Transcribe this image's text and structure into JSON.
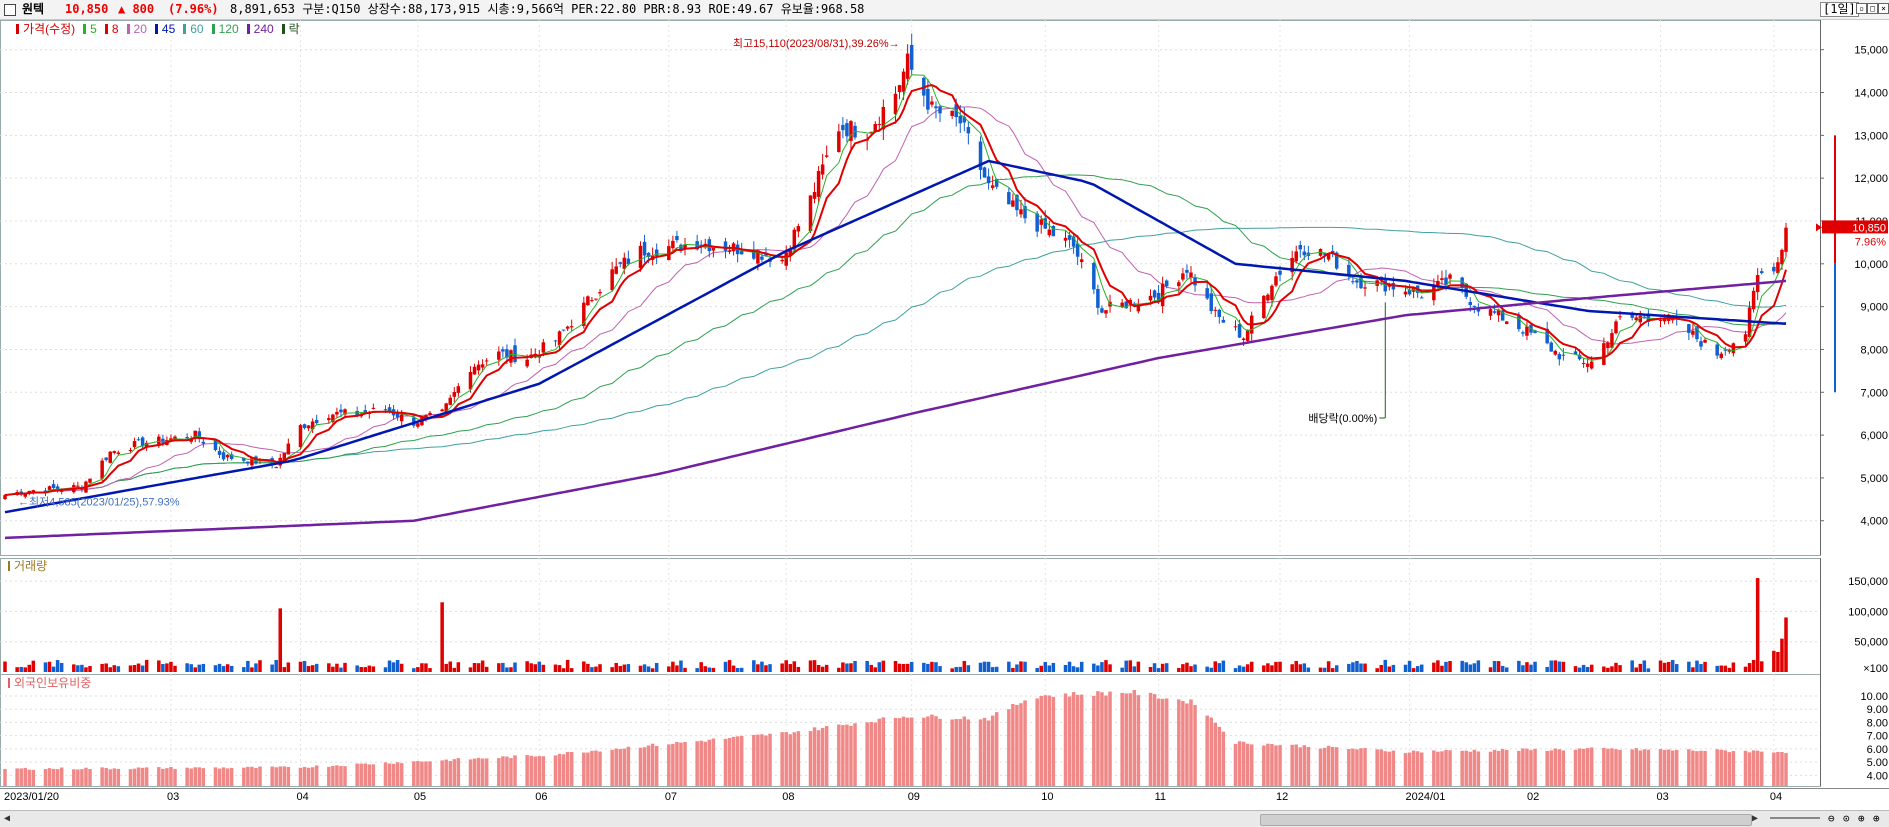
{
  "header": {
    "stock_name": "원텍",
    "price": "10,850",
    "change": "▲ 800",
    "change_pct": "(7.96%)",
    "stats": "8,891,653 구분:Q150 상장수:88,173,915 시총:9,566억 PER:22.80 PBR:8.93 ROE:49.67 유보율:968.58",
    "period": "[1일]"
  },
  "price_panel": {
    "legend": [
      {
        "label": "가격(수정)",
        "color": "#d40000"
      },
      {
        "label": "5",
        "color": "#2bb02b"
      },
      {
        "label": "8",
        "color": "#e00000"
      },
      {
        "label": "20",
        "color": "#c060b0"
      },
      {
        "label": "45",
        "color": "#0018b0"
      },
      {
        "label": "60",
        "color": "#40a0a0"
      },
      {
        "label": "120",
        "color": "#30a050"
      },
      {
        "label": "240",
        "color": "#7020a0"
      },
      {
        "label": "락",
        "color": "#205020"
      }
    ],
    "high_annotation": "최고15,110(2023/08/31),39.26%→",
    "low_annotation": "←최저4,585(2023/01/25),57.93%",
    "dividend_annotation": "배당락(0.00%)",
    "current_price_label": "10,850",
    "current_pct_label": "7.96%"
  },
  "volume_panel": {
    "legend": "거래량"
  },
  "foreign_panel": {
    "legend": "외국인보유비중"
  },
  "x_axis_labels": [
    "2023/01/20",
    "03",
    "04",
    "05",
    "06",
    "07",
    "08",
    "09",
    "10",
    "11",
    "12",
    "2024/01",
    "02",
    "03",
    "04"
  ],
  "chart_data": [
    {
      "type": "candlestick",
      "title": "가격(수정)",
      "y_ticks": [
        "4,000",
        "5,000",
        "6,000",
        "7,000",
        "8,000",
        "9,000",
        "10,000",
        "11,000",
        "12,000",
        "13,000",
        "14,000",
        "15,000"
      ],
      "ylim": [
        3200,
        15600
      ],
      "close_trend": [
        [
          "2023/01/20",
          4600
        ],
        [
          "2023/01/25",
          4700
        ],
        [
          "2023/02/01",
          4750
        ],
        [
          "2023/02/08",
          4800
        ],
        [
          "2023/02/15",
          5600
        ],
        [
          "2023/02/22",
          5800
        ],
        [
          "2023/03/01",
          5900
        ],
        [
          "2023/03/08",
          6000
        ],
        [
          "2023/03/15",
          5500
        ],
        [
          "2023/03/22",
          5400
        ],
        [
          "2023/03/28",
          5300
        ],
        [
          "2023/04/03",
          6200
        ],
        [
          "2023/04/10",
          6500
        ],
        [
          "2023/04/17",
          6500
        ],
        [
          "2023/04/24",
          6600
        ],
        [
          "2023/05/01",
          6300
        ],
        [
          "2023/05/08",
          6500
        ],
        [
          "2023/05/15",
          7600
        ],
        [
          "2023/05/22",
          7900
        ],
        [
          "2023/05/29",
          7800
        ],
        [
          "2023/06/05",
          8200
        ],
        [
          "2023/06/12",
          9000
        ],
        [
          "2023/06/19",
          9800
        ],
        [
          "2023/06/26",
          10300
        ],
        [
          "2023/07/03",
          10400
        ],
        [
          "2023/07/10",
          10500
        ],
        [
          "2023/07/17",
          10400
        ],
        [
          "2023/07/24",
          10300
        ],
        [
          "2023/07/31",
          10100
        ],
        [
          "2023/08/07",
          11500
        ],
        [
          "2023/08/14",
          13200
        ],
        [
          "2023/08/21",
          13100
        ],
        [
          "2023/08/28",
          14000
        ],
        [
          "2023/08/31",
          14700
        ],
        [
          "2023/09/06",
          13600
        ],
        [
          "2023/09/13",
          13300
        ],
        [
          "2023/09/20",
          11800
        ],
        [
          "2023/09/27",
          11200
        ],
        [
          "2023/10/04",
          10800
        ],
        [
          "2023/10/11",
          10400
        ],
        [
          "2023/10/18",
          8900
        ],
        [
          "2023/10/25",
          9100
        ],
        [
          "2023/11/01",
          9300
        ],
        [
          "2023/11/08",
          9900
        ],
        [
          "2023/11/15",
          8800
        ],
        [
          "2023/11/22",
          8300
        ],
        [
          "2023/11/29",
          9600
        ],
        [
          "2023/12/06",
          10400
        ],
        [
          "2023/12/13",
          10200
        ],
        [
          "2023/12/20",
          9600
        ],
        [
          "2023/12/28",
          9500
        ],
        [
          "2024/01/05",
          9300
        ],
        [
          "2024/01/12",
          9600
        ],
        [
          "2024/01/19",
          9000
        ],
        [
          "2024/01/26",
          8700
        ],
        [
          "2024/02/02",
          8300
        ],
        [
          "2024/02/09",
          7800
        ],
        [
          "2024/02/16",
          7700
        ],
        [
          "2024/02/23",
          8700
        ],
        [
          "2024/03/04",
          8800
        ],
        [
          "2024/03/11",
          8400
        ],
        [
          "2024/03/18",
          7900
        ],
        [
          "2024/03/25",
          8400
        ],
        [
          "2024/03/28",
          9700
        ],
        [
          "2024/04/02",
          10050
        ],
        [
          "2024/04/04",
          10850
        ]
      ],
      "series": [
        {
          "name": "8",
          "values_trend": "close smoothed over 8 days"
        },
        {
          "name": "45",
          "values": [
            [
              "2023/01/20",
              4200
            ],
            [
              "2023/04/01",
              5400
            ],
            [
              "2023/06/01",
              7200
            ],
            [
              "2023/08/01",
              10300
            ],
            [
              "2023/09/20",
              12400
            ],
            [
              "2023/10/15",
              11900
            ],
            [
              "2023/11/20",
              10000
            ],
            [
              "2024/01/01",
              9600
            ],
            [
              "2024/02/15",
              8900
            ],
            [
              "2024/04/04",
              8600
            ]
          ]
        },
        {
          "name": "240",
          "values": [
            [
              "2023/01/20",
              3600
            ],
            [
              "2023/05/01",
              4000
            ],
            [
              "2023/07/01",
              5100
            ],
            [
              "2023/09/01",
              6500
            ],
            [
              "2023/11/01",
              7800
            ],
            [
              "2024/01/01",
              8800
            ],
            [
              "2024/02/15",
              9200
            ],
            [
              "2024/04/04",
              9600
            ]
          ]
        }
      ],
      "annotations": [
        {
          "text": "최고15,110(2023/08/31),39.26%",
          "x": "2023/08/31",
          "y": 15110
        },
        {
          "text": "최저4,585(2023/01/25),57.93%",
          "x": "2023/01/25",
          "y": 4585
        },
        {
          "text": "배당락(0.00%)",
          "x": "2023/12/27"
        }
      ]
    },
    {
      "type": "bar",
      "title": "거래량",
      "y_ticks": [
        "×100",
        "50,000",
        "100,000",
        "150,000"
      ],
      "ylim": [
        0,
        165000
      ],
      "values_note": "mostly 5,000–20,000; spikes at 2023/03/29 ≈105,000, 2023/05/08 ≈115,000, 2024/03/28 ≈155,000, 2024/04/04 ≈90,000"
    },
    {
      "type": "bar",
      "title": "외국인보유비중",
      "y_ticks": [
        "4.00",
        "5.00",
        "6.00",
        "7.00",
        "8.00",
        "9.00",
        "10.00"
      ],
      "ylim": [
        3.2,
        10.6
      ],
      "trend": [
        [
          "2023/01/20",
          4.5
        ],
        [
          "2023/04/01",
          4.6
        ],
        [
          "2023/06/01",
          5.5
        ],
        [
          "2023/08/01",
          7.2
        ],
        [
          "2023/08/31",
          8.5
        ],
        [
          "2023/09/20",
          8.3
        ],
        [
          "2023/10/01",
          10.0
        ],
        [
          "2023/10/25",
          10.3
        ],
        [
          "2023/11/10",
          9.5
        ],
        [
          "2023/11/20",
          6.5
        ],
        [
          "2024/01/01",
          5.8
        ],
        [
          "2024/02/15",
          6.0
        ],
        [
          "2024/04/04",
          5.8
        ]
      ]
    }
  ]
}
